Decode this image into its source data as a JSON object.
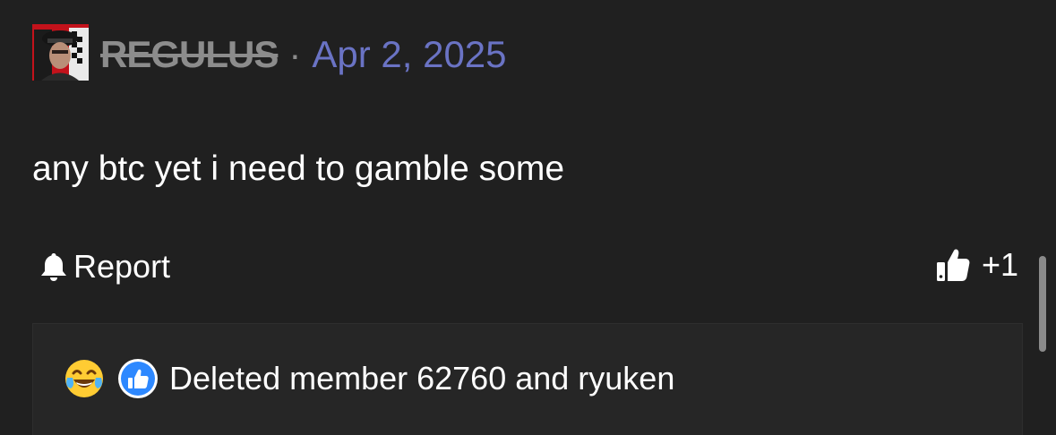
{
  "post": {
    "username": "REGULUS",
    "separator": "·",
    "date": "Apr 2, 2025",
    "message": "any btc yet i need to gamble some"
  },
  "actions": {
    "report_label": "Report",
    "report_icon": "bell-icon",
    "like_icon": "thumbs-up-icon",
    "like_count": "+1"
  },
  "reactions": {
    "icons": [
      "laughing-crying-emoji-icon",
      "like-badge-icon"
    ],
    "summary": "Deleted member 62760 and ryuken"
  },
  "colors": {
    "background": "#202020",
    "username": "#8c8c8c",
    "date": "#6a73c4",
    "text": "#ffffff",
    "like_badge": "#2d88ff"
  }
}
